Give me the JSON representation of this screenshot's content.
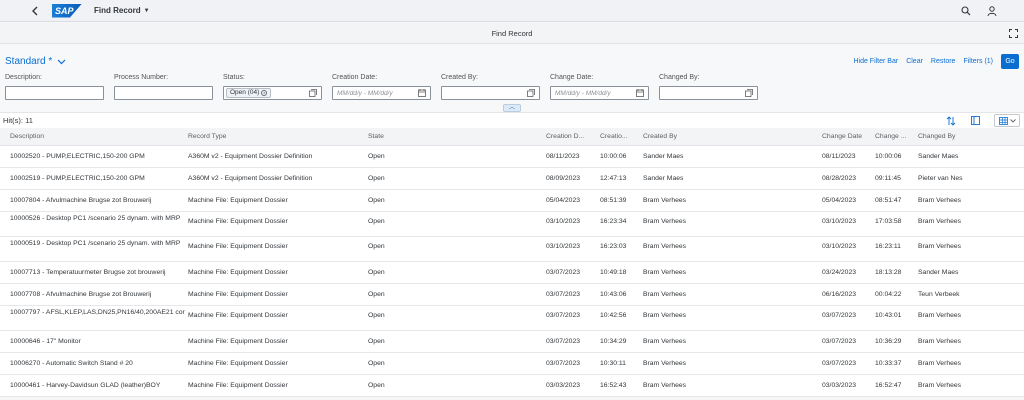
{
  "shell": {
    "logo": "SAP",
    "app_title": "Find Record",
    "icons": [
      "back-icon",
      "search-icon",
      "user-icon"
    ]
  },
  "page": {
    "title": "Find Record"
  },
  "filterbar": {
    "variant": "Standard *",
    "actions": {
      "hide": "Hide Filter Bar",
      "clear": "Clear",
      "restore": "Restore",
      "filters": "Filters (1)",
      "go": "Go"
    },
    "fields": [
      {
        "label": "Description:",
        "value": "",
        "placeholder": ""
      },
      {
        "label": "Process Number:",
        "value": "",
        "placeholder": ""
      },
      {
        "label": "Status:",
        "token": "Open (04)"
      },
      {
        "label": "Creation Date:",
        "placeholder": "MM/dd/y - MM/dd/y"
      },
      {
        "label": "Created By:",
        "value": ""
      },
      {
        "label": "Change Date:",
        "placeholder": "MM/dd/y - MM/dd/y"
      },
      {
        "label": "Changed By:",
        "value": ""
      }
    ]
  },
  "table": {
    "hits": "Hit(s): 11",
    "columns": [
      "Description",
      "Record Type",
      "State",
      "Creation D...",
      "Creatio...",
      "Created By",
      "Change Date",
      "Change ...",
      "Changed By"
    ],
    "rows": [
      [
        "10002520 - PUMP,ELECTRIC,150-200 GPM",
        "A360M v2 - Equipment Dossier Definition",
        "Open",
        "08/11/2023",
        "10:00:06",
        "Sander Maes",
        "08/11/2023",
        "10:00:06",
        "Sander Maes"
      ],
      [
        "10002519 - PUMP,ELECTRIC,150-200 GPM",
        "A360M v2 - Equipment Dossier Definition",
        "Open",
        "08/09/2023",
        "12:47:13",
        "Sander Maes",
        "08/28/2023",
        "09:11:45",
        "Pieter van Nes"
      ],
      [
        "10007804 - Afvulmachine Brugse zot Brouwerij",
        "Machine File: Equipment Dossier",
        "Open",
        "05/04/2023",
        "08:51:39",
        "Bram Verhees",
        "05/04/2023",
        "08:51:47",
        "Bram Verhees"
      ],
      [
        "10000526 - Desktop PC1 /scenario 25 dynam. with MRP",
        "Machine File: Equipment Dossier",
        "Open",
        "03/10/2023",
        "16:23:34",
        "Bram Verhees",
        "03/10/2023",
        "17:03:58",
        "Bram Verhees"
      ],
      [
        "10000519 - Desktop PC1 /scenario 25 dynam. with MRP",
        "Machine File: Equipment Dossier",
        "Open",
        "03/10/2023",
        "16:23:03",
        "Bram Verhees",
        "03/10/2023",
        "16:23:11",
        "Bram Verhees"
      ],
      [
        "10007713 - Temperatuurmeter Brugse zot brouwerij",
        "Machine File: Equipment Dossier",
        "Open",
        "03/07/2023",
        "10:49:18",
        "Bram Verhees",
        "03/24/2023",
        "18:13:28",
        "Sander Maes"
      ],
      [
        "10007708 - Afvulmachine Brugse zot Brouwerij",
        "Machine File: Equipment Dossier",
        "Open",
        "03/07/2023",
        "10:43:06",
        "Bram Verhees",
        "06/16/2023",
        "00:04:22",
        "Teun Verbeek"
      ],
      [
        "10007797 - AFSL,KLEP,LAS,DN25,PN16/40,200AE21 cor",
        "Machine File: Equipment Dossier",
        "Open",
        "03/07/2023",
        "10:42:56",
        "Bram Verhees",
        "03/07/2023",
        "10:43:01",
        "Bram Verhees"
      ],
      [
        "10000646 - 17\" Monitor",
        "Machine File: Equipment Dossier",
        "Open",
        "03/07/2023",
        "10:34:29",
        "Bram Verhees",
        "03/07/2023",
        "10:36:29",
        "Bram Verhees"
      ],
      [
        "10006270 - Automatic Switch Stand # 20",
        "Machine File: Equipment Dossier",
        "Open",
        "03/07/2023",
        "10:30:11",
        "Bram Verhees",
        "03/07/2023",
        "10:33:37",
        "Bram Verhees"
      ],
      [
        "10000461 - Harvey-Davidsun GLAD (leather)BOY",
        "Machine File: Equipment Dossier",
        "Open",
        "03/03/2023",
        "16:52:43",
        "Bram Verhees",
        "03/03/2023",
        "16:52:47",
        "Bram Verhees"
      ]
    ]
  },
  "colors": {
    "accent": "#0a6ed1",
    "shell": "#f0f2f6"
  }
}
